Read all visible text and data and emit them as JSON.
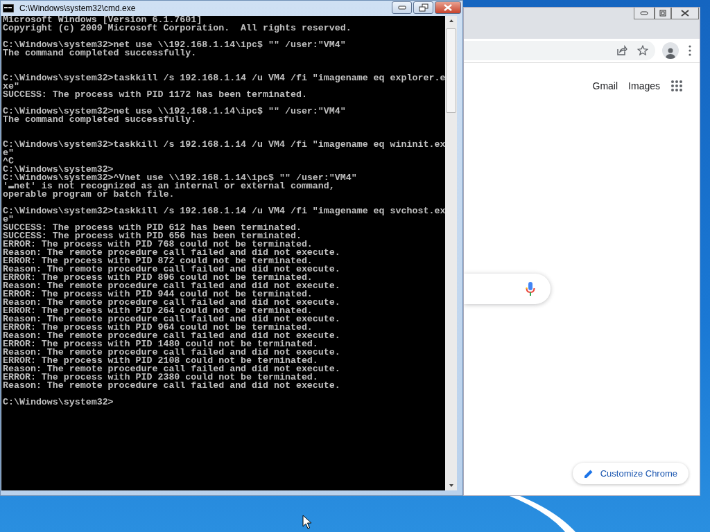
{
  "cmd_window": {
    "title": "C:\\Windows\\system32\\cmd.exe",
    "console_lines": [
      {
        "kind": "text",
        "text": "Microsoft Windows [Version 6.1.7601]"
      },
      {
        "kind": "text",
        "text": "Copyright (c) 2009 Microsoft Corporation.  All rights reserved."
      },
      {
        "kind": "after_one_blank",
        "text": "C:\\Windows\\system32>net use \\\\192.168.1.14\\ipc$ \"\" /user:\"VM4\""
      },
      {
        "kind": "text",
        "text": "The command completed successfully."
      },
      {
        "kind": "after_two_blanks",
        "text": "C:\\Windows\\system32>taskkill /s 192.168.1.14 /u VM4 /fi \"imagename eq explorer.e"
      },
      {
        "kind": "text",
        "text": "xe\""
      },
      {
        "kind": "text",
        "text": "SUCCESS: The process with PID 1172 has been terminated."
      },
      {
        "kind": "after_one_blank",
        "text": "C:\\Windows\\system32>net use \\\\192.168.1.14\\ipc$ \"\" /user:\"VM4\""
      },
      {
        "kind": "text",
        "text": "The command completed successfully."
      },
      {
        "kind": "after_two_blanks",
        "text": "C:\\Windows\\system32>taskkill /s 192.168.1.14 /u VM4 /fi \"imagename eq wininit.ex"
      },
      {
        "kind": "text",
        "text": "e\""
      },
      {
        "kind": "text",
        "text": "^C"
      },
      {
        "kind": "text",
        "text": "C:\\Windows\\system32>"
      },
      {
        "kind": "text",
        "text": "C:\\Windows\\system32>^Vnet use \\\\192.168.1.14\\ipc$ \"\" /user:\"VM4\""
      },
      {
        "kind": "text",
        "text": "'▬net' is not recognized as an internal or external command,"
      },
      {
        "kind": "text",
        "text": "operable program or batch file."
      },
      {
        "kind": "after_one_blank",
        "text": "C:\\Windows\\system32>taskkill /s 192.168.1.14 /u VM4 /fi \"imagename eq svchost.ex"
      },
      {
        "kind": "text",
        "text": "e\""
      },
      {
        "kind": "text",
        "text": "SUCCESS: The process with PID 612 has been terminated."
      },
      {
        "kind": "text",
        "text": "SUCCESS: The process with PID 656 has been terminated."
      },
      {
        "kind": "text",
        "text": "ERROR: The process with PID 768 could not be terminated."
      },
      {
        "kind": "text",
        "text": "Reason: The remote procedure call failed and did not execute."
      },
      {
        "kind": "text",
        "text": "ERROR: The process with PID 872 could not be terminated."
      },
      {
        "kind": "text",
        "text": "Reason: The remote procedure call failed and did not execute."
      },
      {
        "kind": "text",
        "text": "ERROR: The process with PID 896 could not be terminated."
      },
      {
        "kind": "text",
        "text": "Reason: The remote procedure call failed and did not execute."
      },
      {
        "kind": "text",
        "text": "ERROR: The process with PID 944 could not be terminated."
      },
      {
        "kind": "text",
        "text": "Reason: The remote procedure call failed and did not execute."
      },
      {
        "kind": "text",
        "text": "ERROR: The process with PID 264 could not be terminated."
      },
      {
        "kind": "text",
        "text": "Reason: The remote procedure call failed and did not execute."
      },
      {
        "kind": "text",
        "text": "ERROR: The process with PID 964 could not be terminated."
      },
      {
        "kind": "text",
        "text": "Reason: The remote procedure call failed and did not execute."
      },
      {
        "kind": "text",
        "text": "ERROR: The process with PID 1480 could not be terminated."
      },
      {
        "kind": "text",
        "text": "Reason: The remote procedure call failed and did not execute."
      },
      {
        "kind": "text",
        "text": "ERROR: The process with PID 2108 could not be terminated."
      },
      {
        "kind": "text",
        "text": "Reason: The remote procedure call failed and did not execute."
      },
      {
        "kind": "text",
        "text": "ERROR: The process with PID 2380 could not be terminated."
      },
      {
        "kind": "text",
        "text": "Reason: The remote procedure call failed and did not execute."
      },
      {
        "kind": "after_one_blank",
        "text": "C:\\Windows\\system32>"
      }
    ]
  },
  "browser_window": {
    "links": [
      "Gmail",
      "Images"
    ],
    "customize_button": "Customize Chrome"
  }
}
